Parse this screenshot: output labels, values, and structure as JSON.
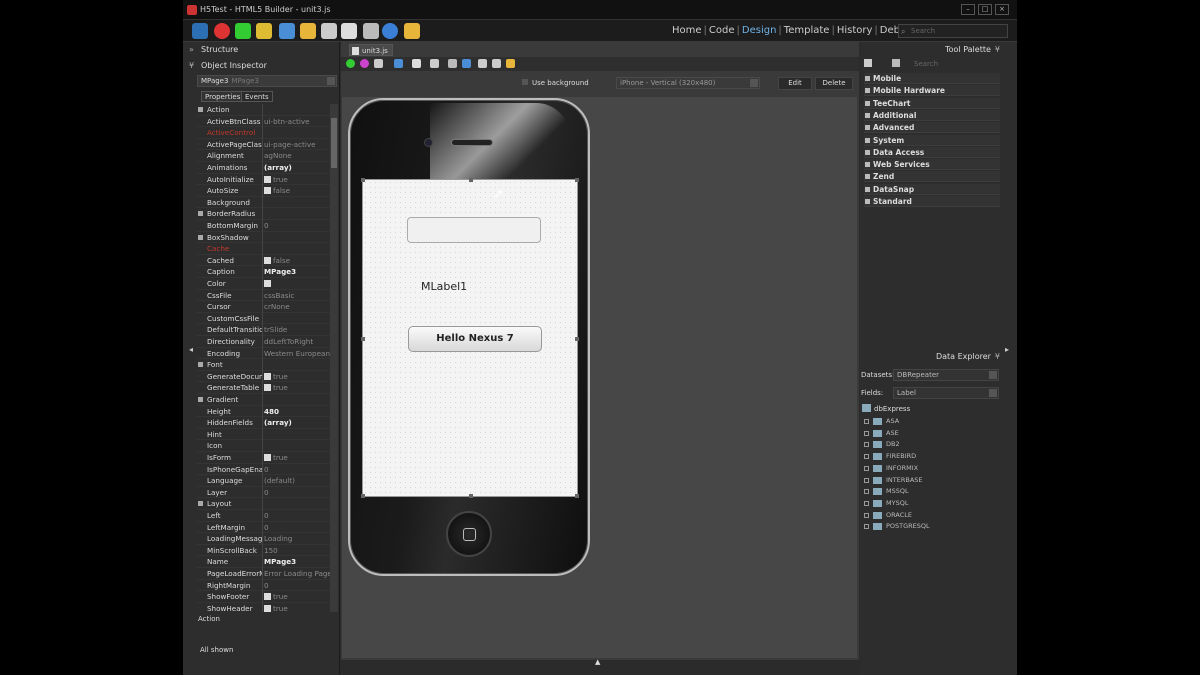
{
  "window": {
    "title": "H5Test - HTML5 Builder - unit3.js"
  },
  "nav": {
    "home": "Home",
    "code": "Code",
    "design": "Design",
    "template": "Template",
    "history": "History",
    "debug": "Debug",
    "separator": "|"
  },
  "search": {
    "placeholder": "Search"
  },
  "left_panel": {
    "structure_title": "Structure",
    "inspector_title": "Object Inspector",
    "object_name": "MPage3",
    "object_sub": "MPage3",
    "tabs": [
      "Properties",
      "Events"
    ],
    "properties": [
      {
        "name": "Action",
        "value": "",
        "expand": true
      },
      {
        "name": "ActiveBtnClass",
        "value": "ui-btn-active"
      },
      {
        "name": "ActiveControl",
        "value": "",
        "red": true
      },
      {
        "name": "ActivePageClass",
        "value": "ui-page-active"
      },
      {
        "name": "Alignment",
        "value": "agNone"
      },
      {
        "name": "Animations",
        "value": "(array)",
        "bold": true
      },
      {
        "name": "AutoInitialize",
        "value": "true",
        "check": true
      },
      {
        "name": "AutoSize",
        "value": "false",
        "check": true
      },
      {
        "name": "Background",
        "value": ""
      },
      {
        "name": "BorderRadius",
        "value": "",
        "expand": true
      },
      {
        "name": "BottomMargin",
        "value": "0"
      },
      {
        "name": "BoxShadow",
        "value": "",
        "expand": true
      },
      {
        "name": "Cache",
        "value": "",
        "red": true
      },
      {
        "name": "Cached",
        "value": "false",
        "check": true
      },
      {
        "name": "Caption",
        "value": "MPage3",
        "bold": true
      },
      {
        "name": "Color",
        "value": "",
        "swatch": true
      },
      {
        "name": "CssFile",
        "value": "cssBasic"
      },
      {
        "name": "Cursor",
        "value": "crNone"
      },
      {
        "name": "CustomCssFile",
        "value": ""
      },
      {
        "name": "DefaultTransitio",
        "value": "trSlide"
      },
      {
        "name": "Directionality",
        "value": "ddLeftToRight"
      },
      {
        "name": "Encoding",
        "value": "Western European"
      },
      {
        "name": "Font",
        "value": "",
        "expand": true
      },
      {
        "name": "GenerateDocum",
        "value": "true",
        "check": true
      },
      {
        "name": "GenerateTable",
        "value": "true",
        "check": true
      },
      {
        "name": "Gradient",
        "value": "",
        "expand": true
      },
      {
        "name": "Height",
        "value": "480",
        "bold": true
      },
      {
        "name": "HiddenFields",
        "value": "(array)",
        "bold": true
      },
      {
        "name": "Hint",
        "value": ""
      },
      {
        "name": "Icon",
        "value": ""
      },
      {
        "name": "IsForm",
        "value": "true",
        "check": true
      },
      {
        "name": "IsPhoneGapEnal",
        "value": "0"
      },
      {
        "name": "Language",
        "value": "(default)"
      },
      {
        "name": "Layer",
        "value": "0"
      },
      {
        "name": "Layout",
        "value": "",
        "expand": true
      },
      {
        "name": "Left",
        "value": "0"
      },
      {
        "name": "LeftMargin",
        "value": "0"
      },
      {
        "name": "LoadingMessag",
        "value": "Loading"
      },
      {
        "name": "MinScrollBack",
        "value": "150"
      },
      {
        "name": "Name",
        "value": "MPage3",
        "bold": true
      },
      {
        "name": "PageLoadErrorM",
        "value": "Error Loading Page"
      },
      {
        "name": "RightMargin",
        "value": "0"
      },
      {
        "name": "ShowFooter",
        "value": "true",
        "check": true
      },
      {
        "name": "ShowHeader",
        "value": "true",
        "check": true
      }
    ],
    "action_label": "Action",
    "all_shown": "All shown"
  },
  "designer": {
    "doc_tab": "unit3.js",
    "use_background": "Use background",
    "device": "iPhone - Vertical (320x480)",
    "edit_label": "Edit",
    "delete_label": "Delete",
    "mlabel": "MLabel1",
    "button_caption": "Hello Nexus 7"
  },
  "tool_palette": {
    "title": "Tool Palette",
    "search_placeholder": "Search",
    "categories": [
      "Mobile",
      "Mobile Hardware",
      "TeeChart",
      "Additional",
      "Advanced",
      "System",
      "Data Access",
      "Web Services",
      "Zend",
      "DataSnap",
      "Standard"
    ]
  },
  "data_explorer": {
    "title": "Data Explorer",
    "datasets_label": "Datasets:",
    "datasets_value": "DBRepeater",
    "fields_label": "Fields:",
    "fields_value": "Label",
    "root": "dbExpress",
    "items": [
      "ASA",
      "ASE",
      "DB2",
      "FIREBIRD",
      "INFORMIX",
      "INTERBASE",
      "MSSQL",
      "MYSQL",
      "ORACLE",
      "POSTGRESQL"
    ]
  }
}
